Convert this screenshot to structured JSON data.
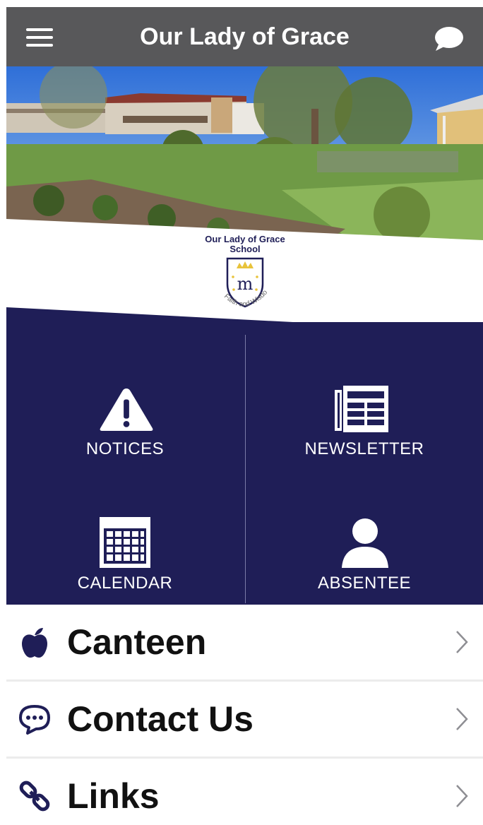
{
  "header": {
    "title": "Our Lady of Grace",
    "menu_icon": "hamburger-menu-icon",
    "chat_icon": "speech-bubble-icon"
  },
  "hero": {
    "description_icon": "school-campus-photo"
  },
  "logo": {
    "name_line1": "Our Lady of Grace",
    "name_line2": "School",
    "motto": "Faith and Wisdom"
  },
  "tiles": [
    {
      "label": "NOTICES",
      "icon": "warning-triangle-icon"
    },
    {
      "label": "NEWSLETTER",
      "icon": "newspaper-icon"
    },
    {
      "label": "CALENDAR",
      "icon": "calendar-icon"
    },
    {
      "label": "ABSENTEE",
      "icon": "person-icon"
    }
  ],
  "list": [
    {
      "label": "Canteen",
      "icon": "apple-icon"
    },
    {
      "label": "Contact Us",
      "icon": "chat-bubble-icon"
    },
    {
      "label": "Links",
      "icon": "link-chain-icon"
    }
  ],
  "colors": {
    "header_bg": "#58585a",
    "navy": "#1f1e57",
    "white": "#ffffff"
  }
}
